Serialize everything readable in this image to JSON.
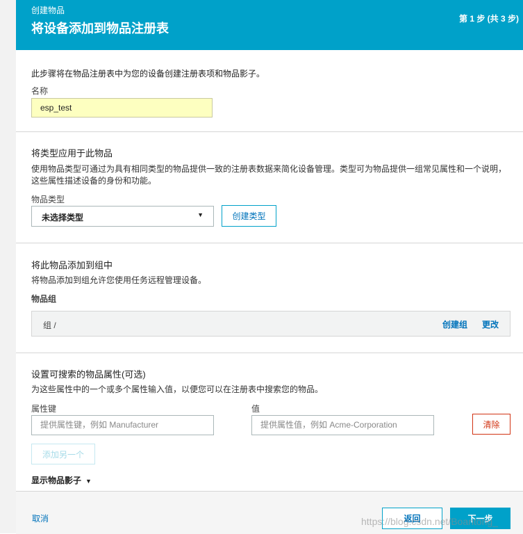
{
  "header": {
    "breadcrumb": "创建物品",
    "title": "将设备添加到物品注册表",
    "step": "第 1 步 (共 3 步)"
  },
  "intro": "此步骤将在物品注册表中为您的设备创建注册表项和物品影子。",
  "name_section": {
    "label": "名称",
    "value": "esp_test"
  },
  "type_section": {
    "title": "将类型应用于此物品",
    "description": "使用物品类型可通过为具有相同类型的物品提供一致的注册表数据来简化设备管理。类型可为物品提供一组常见属性和一个说明，这些属性描述设备的身份和功能。",
    "label": "物品类型",
    "selected": "未选择类型",
    "create_button": "创建类型"
  },
  "group_section": {
    "title": "将此物品添加到组中",
    "description": "将物品添加到组允许您使用任务远程管理设备。",
    "label": "物品组",
    "path": "组 /",
    "create_link": "创建组",
    "change_link": "更改"
  },
  "attributes_section": {
    "title": "设置可搜索的物品属性(可选)",
    "description": "为这些属性中的一个或多个属性输入值，以便您可以在注册表中搜索您的物品。",
    "key_label": "属性键",
    "value_label": "值",
    "key_placeholder": "提供属性键，例如 Manufacturer",
    "value_placeholder": "提供属性值，例如 Acme-Corporation",
    "clear_button": "清除",
    "add_button": "添加另一个",
    "shadow_toggle": "显示物品影子"
  },
  "footer": {
    "cancel": "取消",
    "back": "返回",
    "next": "下一步"
  },
  "watermark": "https://blog.csdn.net/Boantong_",
  "colors": {
    "accent": "#00a1c9",
    "link": "#0073bb",
    "danger": "#d13212",
    "input_highlight": "#fdffc0"
  }
}
